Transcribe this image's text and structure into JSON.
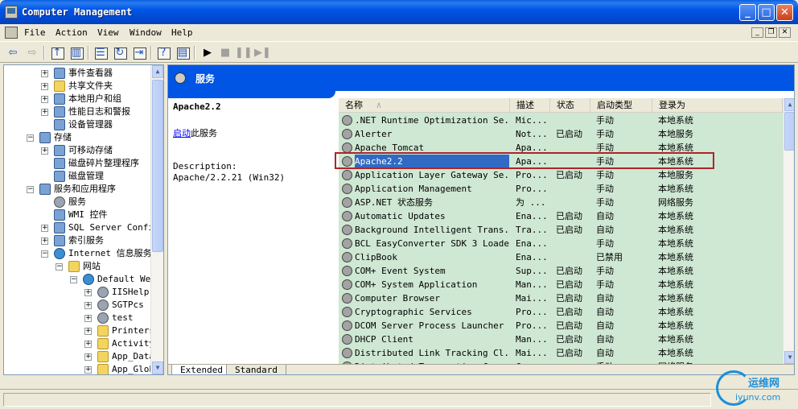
{
  "window": {
    "title": "Computer Management"
  },
  "menu": [
    "File",
    "Action",
    "View",
    "Window",
    "Help"
  ],
  "tree": [
    {
      "label": "事件查看器",
      "indent": 1,
      "exp": "+",
      "icon": "event-viewer-icon"
    },
    {
      "label": "共享文件夹",
      "indent": 1,
      "exp": "+",
      "icon": "shared-folder-icon"
    },
    {
      "label": "本地用户和组",
      "indent": 1,
      "exp": "+",
      "icon": "users-icon"
    },
    {
      "label": "性能日志和警报",
      "indent": 1,
      "exp": "+",
      "icon": "performance-icon"
    },
    {
      "label": "设备管理器",
      "indent": 1,
      "exp": "",
      "icon": "device-manager-icon"
    },
    {
      "label": "存储",
      "indent": 0,
      "exp": "−",
      "icon": "storage-icon"
    },
    {
      "label": "可移动存储",
      "indent": 1,
      "exp": "+",
      "icon": "removable-storage-icon"
    },
    {
      "label": "磁盘碎片整理程序",
      "indent": 1,
      "exp": "",
      "icon": "defrag-icon"
    },
    {
      "label": "磁盘管理",
      "indent": 1,
      "exp": "",
      "icon": "disk-management-icon"
    },
    {
      "label": "服务和应用程序",
      "indent": 0,
      "exp": "−",
      "icon": "services-apps-icon"
    },
    {
      "label": "服务",
      "indent": 1,
      "exp": "",
      "icon": "services-gear-icon"
    },
    {
      "label": "WMI 控件",
      "indent": 1,
      "exp": "",
      "icon": "wmi-icon"
    },
    {
      "label": "SQL Server Configura",
      "indent": 1,
      "exp": "+",
      "icon": "sql-server-icon"
    },
    {
      "label": "索引服务",
      "indent": 1,
      "exp": "+",
      "icon": "indexing-icon"
    },
    {
      "label": "Internet 信息服务",
      "indent": 1,
      "exp": "−",
      "icon": "iis-icon"
    },
    {
      "label": "网站",
      "indent": 2,
      "exp": "−",
      "icon": "websites-folder-icon"
    },
    {
      "label": "Default Web S",
      "indent": 3,
      "exp": "−",
      "icon": "globe-icon"
    },
    {
      "label": "IISHelp",
      "indent": 4,
      "exp": "+",
      "icon": "gear-icon"
    },
    {
      "label": "SGTPcs",
      "indent": 4,
      "exp": "+",
      "icon": "gear-icon"
    },
    {
      "label": "test",
      "indent": 4,
      "exp": "+",
      "icon": "gear-icon"
    },
    {
      "label": "Printers",
      "indent": 4,
      "exp": "+",
      "icon": "folder-icon"
    },
    {
      "label": "ActivityCo",
      "indent": 4,
      "exp": "+",
      "icon": "folder-icon"
    },
    {
      "label": "App_Data",
      "indent": 4,
      "exp": "+",
      "icon": "folder-icon"
    },
    {
      "label": "App_Global",
      "indent": 4,
      "exp": "+",
      "icon": "folder-icon"
    }
  ],
  "pane": {
    "header": "服务",
    "service_name": "Apache2.2",
    "start_link": "启动",
    "start_suffix": "此服务",
    "desc_label": "Description:",
    "desc_text": "Apache/2.2.21 (Win32)"
  },
  "columns": [
    "名称",
    "描述",
    "状态",
    "启动类型",
    "登录为"
  ],
  "sort_arrow": "∧",
  "services": [
    {
      "name": ".NET Runtime Optimization Se...",
      "desc": "Mic...",
      "status": "",
      "startup": "手动",
      "logon": "本地系统"
    },
    {
      "name": "Alerter",
      "desc": "Not...",
      "status": "已启动",
      "startup": "手动",
      "logon": "本地服务"
    },
    {
      "name": "Apache Tomcat",
      "desc": "Apa...",
      "status": "",
      "startup": "手动",
      "logon": "本地系统"
    },
    {
      "name": "Apache2.2",
      "desc": "Apa...",
      "status": "",
      "startup": "手动",
      "logon": "本地系统"
    },
    {
      "name": "Application Layer Gateway Se...",
      "desc": "Pro...",
      "status": "已启动",
      "startup": "手动",
      "logon": "本地服务"
    },
    {
      "name": "Application Management",
      "desc": "Pro...",
      "status": "",
      "startup": "手动",
      "logon": "本地系统"
    },
    {
      "name": "ASP.NET 状态服务",
      "desc": "为 ...",
      "status": "",
      "startup": "手动",
      "logon": "网络服务"
    },
    {
      "name": "Automatic Updates",
      "desc": "Ena...",
      "status": "已启动",
      "startup": "自动",
      "logon": "本地系统"
    },
    {
      "name": "Background Intelligent Trans...",
      "desc": "Tra...",
      "status": "已启动",
      "startup": "自动",
      "logon": "本地系统"
    },
    {
      "name": "BCL EasyConverter SDK 3 Loader",
      "desc": "Ena...",
      "status": "",
      "startup": "手动",
      "logon": "本地系统"
    },
    {
      "name": "ClipBook",
      "desc": "Ena...",
      "status": "",
      "startup": "已禁用",
      "logon": "本地系统"
    },
    {
      "name": "COM+ Event System",
      "desc": "Sup...",
      "status": "已启动",
      "startup": "手动",
      "logon": "本地系统"
    },
    {
      "name": "COM+ System Application",
      "desc": "Man...",
      "status": "已启动",
      "startup": "手动",
      "logon": "本地系统"
    },
    {
      "name": "Computer Browser",
      "desc": "Mai...",
      "status": "已启动",
      "startup": "自动",
      "logon": "本地系统"
    },
    {
      "name": "Cryptographic Services",
      "desc": "Pro...",
      "status": "已启动",
      "startup": "自动",
      "logon": "本地系统"
    },
    {
      "name": "DCOM Server Process Launcher",
      "desc": "Pro...",
      "status": "已启动",
      "startup": "自动",
      "logon": "本地系统"
    },
    {
      "name": "DHCP Client",
      "desc": "Man...",
      "status": "已启动",
      "startup": "自动",
      "logon": "本地系统"
    },
    {
      "name": "Distributed Link Tracking Cl...",
      "desc": "Mai...",
      "status": "已启动",
      "startup": "自动",
      "logon": "本地系统"
    },
    {
      "name": "Distributed Transaction Coor...",
      "desc": "Coo...",
      "status": "",
      "startup": "手动",
      "logon": "网络服务"
    }
  ],
  "selected_index": 3,
  "tabs": [
    "Extended",
    "Standard"
  ],
  "watermark": {
    "cn": "运维网",
    "url": "iyunv.com"
  }
}
